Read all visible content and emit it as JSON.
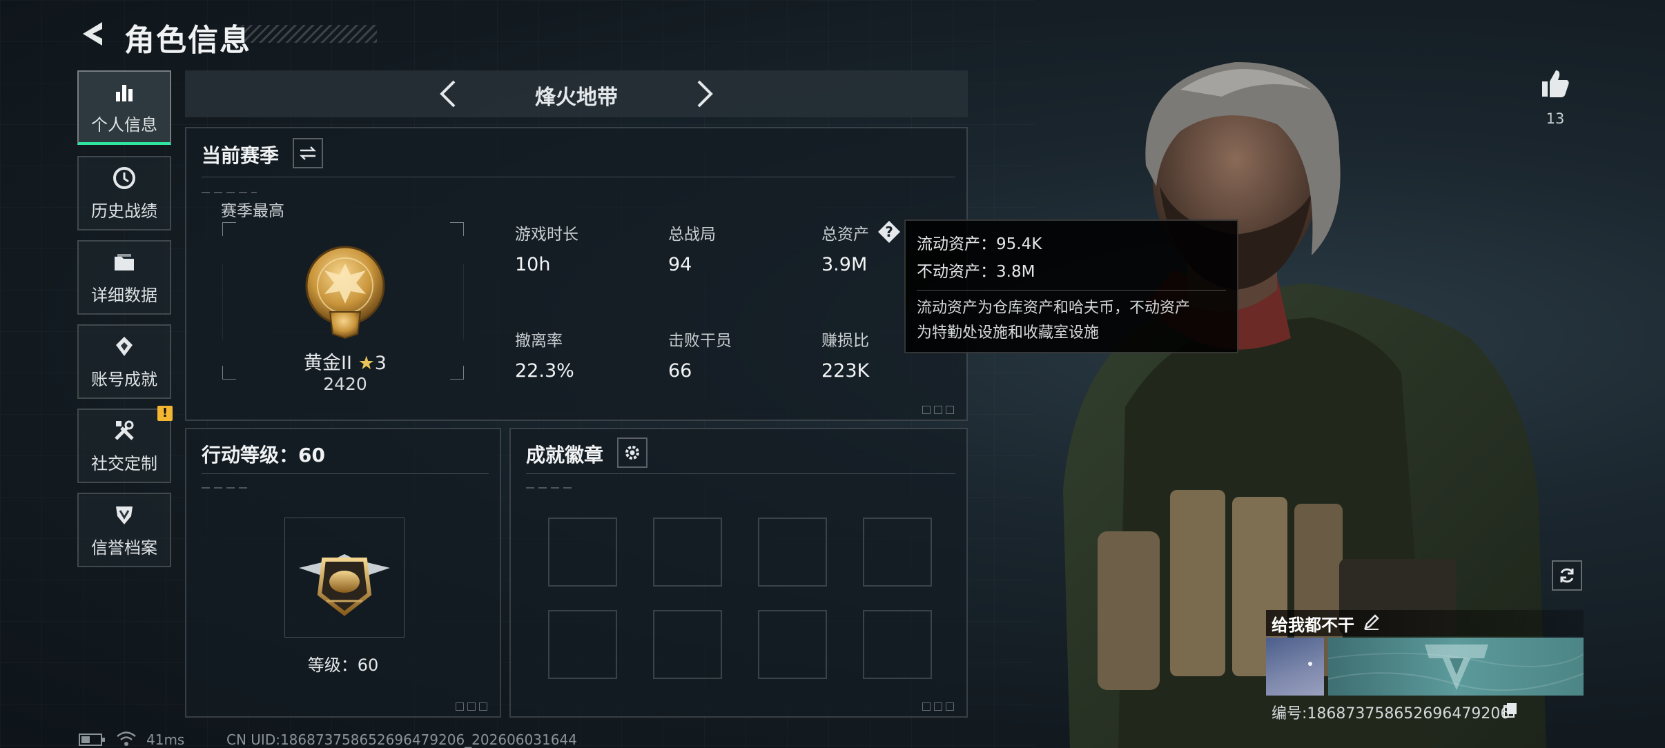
{
  "header": {
    "title": "角色信息"
  },
  "sidebar": {
    "items": [
      {
        "label": "个人信息",
        "icon": "bar-chart-icon",
        "active": true
      },
      {
        "label": "历史战绩",
        "icon": "history-icon"
      },
      {
        "label": "详细数据",
        "icon": "folder-icon"
      },
      {
        "label": "账号成就",
        "icon": "achievement-icon"
      },
      {
        "label": "社交定制",
        "icon": "tools-icon",
        "alert": "!"
      },
      {
        "label": "信誉档案",
        "icon": "shield-icon"
      }
    ]
  },
  "mode_tab": {
    "label": "烽火地带"
  },
  "season": {
    "title": "当前赛季",
    "best_label": "赛季最高",
    "rank_name": "黄金II",
    "rank_stars": "3",
    "rank_score": "2420",
    "stats": [
      {
        "label": "游戏时长",
        "value": "10h"
      },
      {
        "label": "总战局",
        "value": "94"
      },
      {
        "label": "总资产",
        "value": "3.9M"
      },
      {
        "label": "撤离率",
        "value": "22.3%"
      },
      {
        "label": "击败干员",
        "value": "66"
      },
      {
        "label": "赚损比",
        "value": "223K"
      }
    ]
  },
  "tooltip": {
    "liquid": "流动资产：95.4K",
    "fixed": "不动资产：3.8M",
    "desc_line1": "流动资产为仓库资产和哈夫币，不动资产",
    "desc_line2": "为特勤处设施和收藏室设施"
  },
  "action_level": {
    "title": "行动等级：60",
    "level_text": "等级：60"
  },
  "badges": {
    "title": "成就徽章",
    "slots": 8
  },
  "profile": {
    "likes": "13",
    "player_name": "给我都不干",
    "player_id": "编号:18687375865269647920​6"
  },
  "status_bar": {
    "ping": "41ms",
    "uid": "CN UID:18687375865269647920​6_202606031644"
  },
  "colors": {
    "accent": "#2ee6a0",
    "warning": "#f2b630",
    "gold": "#c9953b"
  }
}
